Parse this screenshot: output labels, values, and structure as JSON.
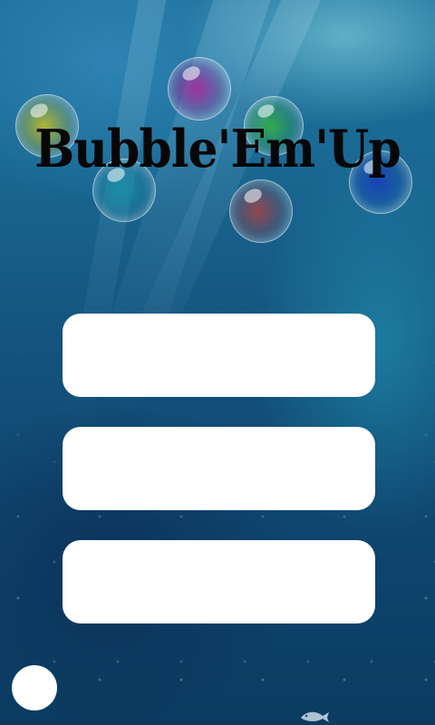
{
  "game": {
    "title": "Bubble'Em'Up"
  },
  "menu": {
    "buttons": [
      {
        "label": ""
      },
      {
        "label": ""
      },
      {
        "label": ""
      }
    ],
    "corner_button": {
      "label": ""
    }
  },
  "bubbles": [
    {
      "name": "bubble-yellow",
      "color": "#c8c020"
    },
    {
      "name": "bubble-purple",
      "color": "#a8289a"
    },
    {
      "name": "bubble-green",
      "color": "#38b048"
    },
    {
      "name": "bubble-teal",
      "color": "#1a90a8"
    },
    {
      "name": "bubble-red",
      "color": "#b04040"
    },
    {
      "name": "bubble-blue",
      "color": "#1840b8"
    }
  ],
  "colors": {
    "background_top": "#1f6f9a",
    "background_bottom": "#0b3b61",
    "button_fill": "#ffffff",
    "logo_text": "#070707"
  }
}
